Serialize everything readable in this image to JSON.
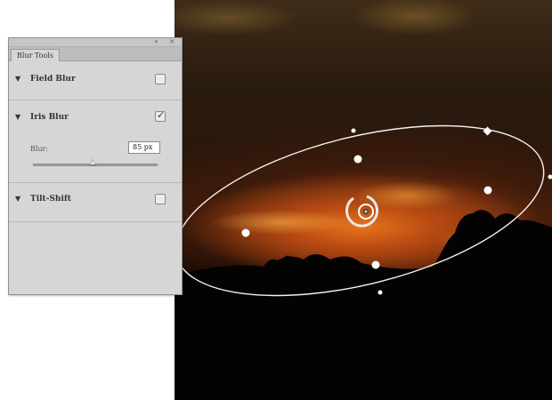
{
  "panel": {
    "tab_label": "Blur Tools",
    "titlebar": {
      "collapse_glyph": "«",
      "close_glyph": "×"
    },
    "sections": {
      "field_blur": {
        "label": "Field Blur",
        "expanded_arrow": "▼",
        "enabled": false
      },
      "iris_blur": {
        "label": "Iris Blur",
        "expanded_arrow": "▼",
        "enabled": true,
        "check_glyph": "✓",
        "blur_label": "Blur:",
        "blur_value": "85 px",
        "blur_slider_fraction": 0.48
      },
      "tilt_shift": {
        "label": "Tilt-Shift",
        "expanded_arrow": "▼",
        "enabled": false
      }
    }
  },
  "icons": {
    "panel_collapse": "double-chevron-icon",
    "panel_close": "close-icon",
    "section_toggle": "triangle-down-icon",
    "checkbox_checked": "checkmark-icon",
    "iris_center": "pin-icon"
  },
  "colors": {
    "panel_bg": "#d6d6d6",
    "overlay_line": "#f2f2f2",
    "sky_glow": "#e8741c"
  }
}
